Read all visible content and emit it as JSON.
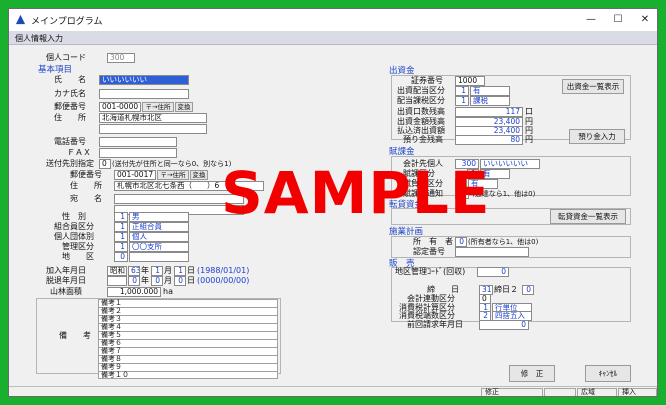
{
  "window": {
    "title": "メインプログラム",
    "subtitle": "個人情報入力",
    "minimize": "—",
    "maximize": "☐",
    "close": "✕"
  },
  "header": {
    "kojin_code_label": "個人コード",
    "kojin_code_value": "300"
  },
  "kihon": {
    "section": "基本項目",
    "name_label": "氏　　名",
    "name_value": "いいいいいい",
    "kana_label": "カナ氏名",
    "kana_value": "",
    "zip_label": "郵便番号",
    "zip_value": "001-0000",
    "zip_btn": "〒→住所",
    "convert_btn": "変換",
    "addr_label": "住　　所",
    "addr_value": "北海道札幌市北区",
    "tel_label": "電話番号",
    "tel_value": "",
    "fax_label": "ＦＡＸ",
    "fax_value": "",
    "sofu_label": "送付先別指定",
    "sofu_value": "0",
    "sofu_note": "(送付先が住所と同一なら0、別なら1)",
    "sofu_zip_label": "郵便番号",
    "sofu_zip_value": "001-0017",
    "sofu_zip_btn": "〒→住所",
    "sofu_convert_btn": "変換",
    "sofu_addr_label": "住　　所",
    "sofu_addr_value": "札幌市北区北七条西（　　）6",
    "atena_label": "宛　　名",
    "atena_value": "",
    "sex_label": "性　別",
    "sex_code": "1",
    "sex_value": "男",
    "kumiai_label": "組合員区分",
    "kumiai_code": "1",
    "kumiai_value": "正組合員",
    "kojindan_label": "個人団体別",
    "kojindan_code": "1",
    "kojindan_value": "個人",
    "kanri_label": "管理区分",
    "kanri_code": "1",
    "kanri_value": "〇〇支所",
    "chiku_label": "地　　区",
    "chiku_code": "0",
    "join_label": "加入年月日",
    "join_era": "昭和",
    "join_y": "63",
    "join_m": "1",
    "join_d": "1",
    "join_western": "1988/01/01",
    "leave_label": "脱退年月日",
    "leave_y": "0",
    "leave_m": "0",
    "leave_d": "0",
    "leave_western": "0000/00/00",
    "nen": "年",
    "tsuki": "月",
    "hi": "日",
    "sanrin_label": "山林面積",
    "sanrin_value": "1,000.000",
    "sanrin_unit": "ha",
    "biko_label": "備　　考",
    "biko": [
      "備考１",
      "備考２",
      "備考３",
      "備考４",
      "備考５",
      "備考６",
      "備考７",
      "備考８",
      "備考９",
      "備考１０"
    ]
  },
  "shusshi": {
    "section": "出資金",
    "shoken_label": "証券番号",
    "shoken_value": "1000",
    "haito_label": "出資配当区分",
    "haito_code": "1",
    "haito_value": "有",
    "kazei_label": "配当課税区分",
    "kazei_code": "1",
    "kazei_value": "課税",
    "kuchi_label": "出資口数残高",
    "kuchi_value": "117",
    "kuchi_unit": "口",
    "kin_label": "出資金額残高",
    "kin_value": "23,400",
    "kin_unit": "円",
    "haraikomi_label": "払込済出資額",
    "haraikomi_value": "23,400",
    "haraikomi_unit": "円",
    "azuke_label": "預り金残高",
    "azuke_value": "80",
    "azuke_unit": "円",
    "list_btn": "出資金一覧表示",
    "azuke_btn": "預り金入力"
  },
  "fuka": {
    "section": "賦課金",
    "kei_label": "会計先個人",
    "kei_code": "300",
    "kei_value": "いいいいいい",
    "kubun_label": "賦課区分",
    "kubun_code": "1",
    "kubun_value": "有",
    "futan_label": "賦負担区分",
    "futan_code": "1",
    "futan_value": "有",
    "tsuchi_label": "賦課金通知",
    "tsuchi_code": "1",
    "tsuchi_note": "(通達なら1、他は0)"
  },
  "tenkan": {
    "section": "転貸資金",
    "btn": "転貸資金一覧表示"
  },
  "shinrin": {
    "section": "施業計画",
    "shoyu_label": "所　有　者",
    "shoyu_code": "0",
    "shoyu_note": "(所有者なら1、他は0)",
    "nintei_label": "認定番号",
    "nintei_value": ""
  },
  "hanbai": {
    "section": "販　売",
    "chiku_label": "地区管理ｺｰﾄﾞ(回収)",
    "chiku_value": "0",
    "shime_label": "締　　日",
    "shime_1": "31",
    "shime_mid": "締日２",
    "shime_2": "0",
    "kai_label": "会計連動区分",
    "kai_value": "0",
    "shohi_label": "消費税計算区分",
    "shohi_code": "1",
    "shohi_value": "行単位",
    "hasu_label": "消費税端数区分",
    "hasu_code": "2",
    "hasu_value": "四捨五入",
    "zenkai_label": "前回請求年月日",
    "zenkai_value": "0"
  },
  "footer": {
    "save_btn": "修　正",
    "cancel_btn": "ｷｬﾝｾﾙ"
  },
  "status": {
    "cell1": "修正",
    "cell2": "",
    "cell3": "広域",
    "cell4": "挿入"
  },
  "watermark": "SAMPLE"
}
